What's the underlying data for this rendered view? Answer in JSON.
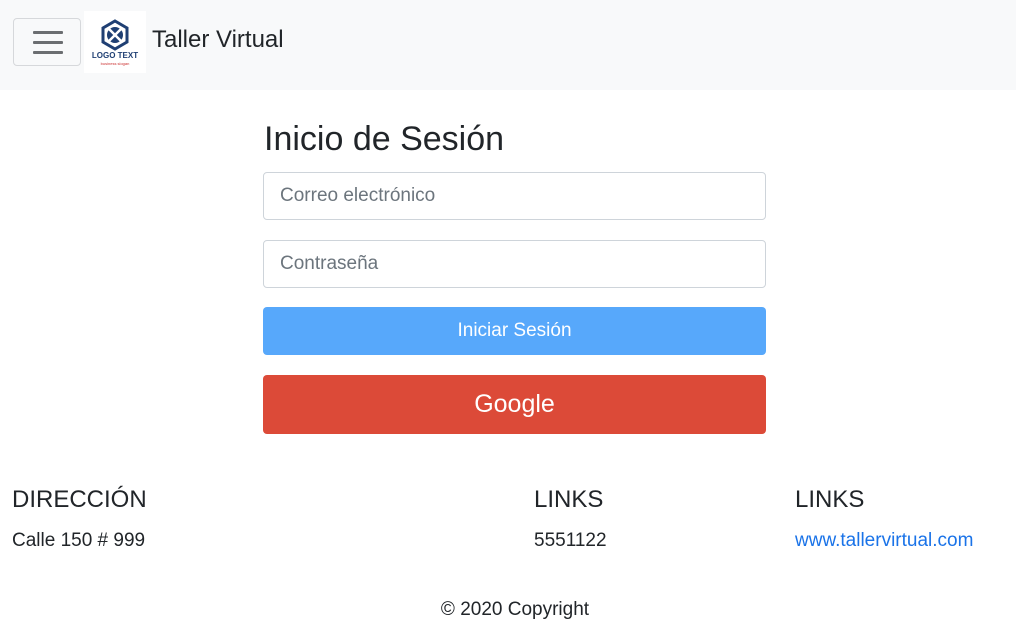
{
  "navbar": {
    "toggler_icon": "hamburger-menu-icon",
    "logo_text": "LOGO TEXT",
    "logo_tagline": "business slogan",
    "brand": "Taller Virtual"
  },
  "login": {
    "title": "Inicio de Sesión",
    "email_placeholder": "Correo electrónico",
    "password_placeholder": "Contraseña",
    "login_button": "Iniciar Sesión",
    "google_button": "Google",
    "colors": {
      "primary": "#57a8fb",
      "google": "#dc4a38"
    }
  },
  "footer": {
    "address": {
      "heading": "DIRECCIÓN",
      "text": "Calle 150 # 999"
    },
    "links_phone": {
      "heading": "LINKS",
      "text": "5551122"
    },
    "links_web": {
      "heading": "LINKS",
      "text": "www.tallervirtual.com"
    },
    "copyright": "© 2020 Copyright"
  }
}
